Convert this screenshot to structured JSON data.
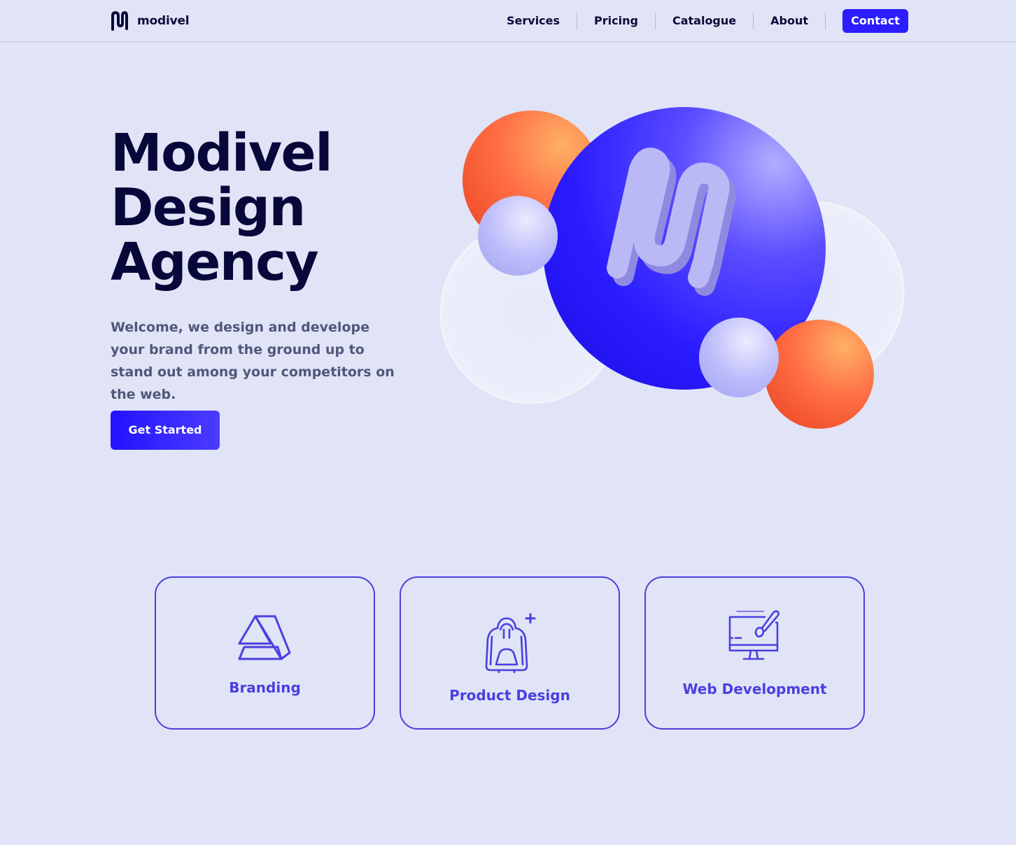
{
  "header": {
    "logo_text": "modivel",
    "nav": [
      {
        "label": "Services"
      },
      {
        "label": "Pricing"
      },
      {
        "label": "Catalogue"
      },
      {
        "label": "About"
      }
    ],
    "contact_label": "Contact"
  },
  "hero": {
    "title_lines": [
      "Modivel",
      "Design",
      "Agency"
    ],
    "description": "Welcome, we design and develope your brand from the ground up to stand out among your competitors on the web.",
    "cta_label": "Get Started",
    "illustration_icon": "modivel-m-logo-icon"
  },
  "services": [
    {
      "label": "Branding",
      "icon": "branding-icon"
    },
    {
      "label": "Product Design",
      "icon": "hoodie-icon"
    },
    {
      "label": "Web Development",
      "icon": "monitor-brush-icon"
    }
  ],
  "colors": {
    "background": "#e0e4f6",
    "primary": "#2b1dff",
    "accent_orange": "#ff6a3d",
    "text_dark": "#07073a",
    "card_border": "#4c3fde"
  }
}
